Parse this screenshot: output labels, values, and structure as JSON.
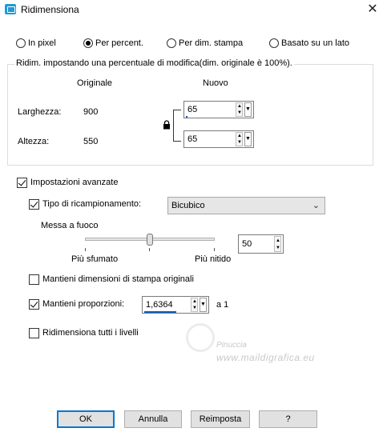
{
  "window": {
    "title": "Ridimensiona",
    "close_glyph": "✕"
  },
  "mode_options": [
    {
      "label": "In pixel",
      "checked": false
    },
    {
      "label": "Per percent.",
      "checked": true
    },
    {
      "label": "Per dim. stampa",
      "checked": false
    },
    {
      "label": "Basato su un lato",
      "checked": false
    }
  ],
  "group": {
    "title": "Ridim. impostando una percentuale di modifica(dim. originale è 100%).",
    "col_original": "Originale",
    "col_new": "Nuovo",
    "width_label": "Larghezza:",
    "width_original": "900",
    "width_new": "65",
    "height_label": "Altezza:",
    "height_original": "550",
    "height_new": "65",
    "lock_icon": "lock-icon"
  },
  "advanced": {
    "label": "Impostazioni avanzate",
    "checked": true,
    "resample_label": "Tipo di ricampionamento:",
    "resample_checked": true,
    "resample_value": "Bicubico",
    "sharpen_label": "Messa a fuoco",
    "sharpen_min_label": "Più sfumato",
    "sharpen_max_label": "Più nitido",
    "sharpen_value": "50",
    "keep_print_label": "Mantieni dimensioni di stampa originali",
    "keep_print_checked": false,
    "keep_ratio_label": "Mantieni proporzioni:",
    "keep_ratio_checked": true,
    "ratio_value": "1,6364",
    "ratio_suffix": "a 1",
    "all_layers_label": "Ridimensiona tutti i livelli",
    "all_layers_checked": false
  },
  "watermark": {
    "line1": "Pinuccia",
    "line2": "www.maildigrafica.eu"
  },
  "buttons": {
    "ok": "OK",
    "cancel": "Annulla",
    "reset": "Reimposta",
    "help": "?"
  }
}
